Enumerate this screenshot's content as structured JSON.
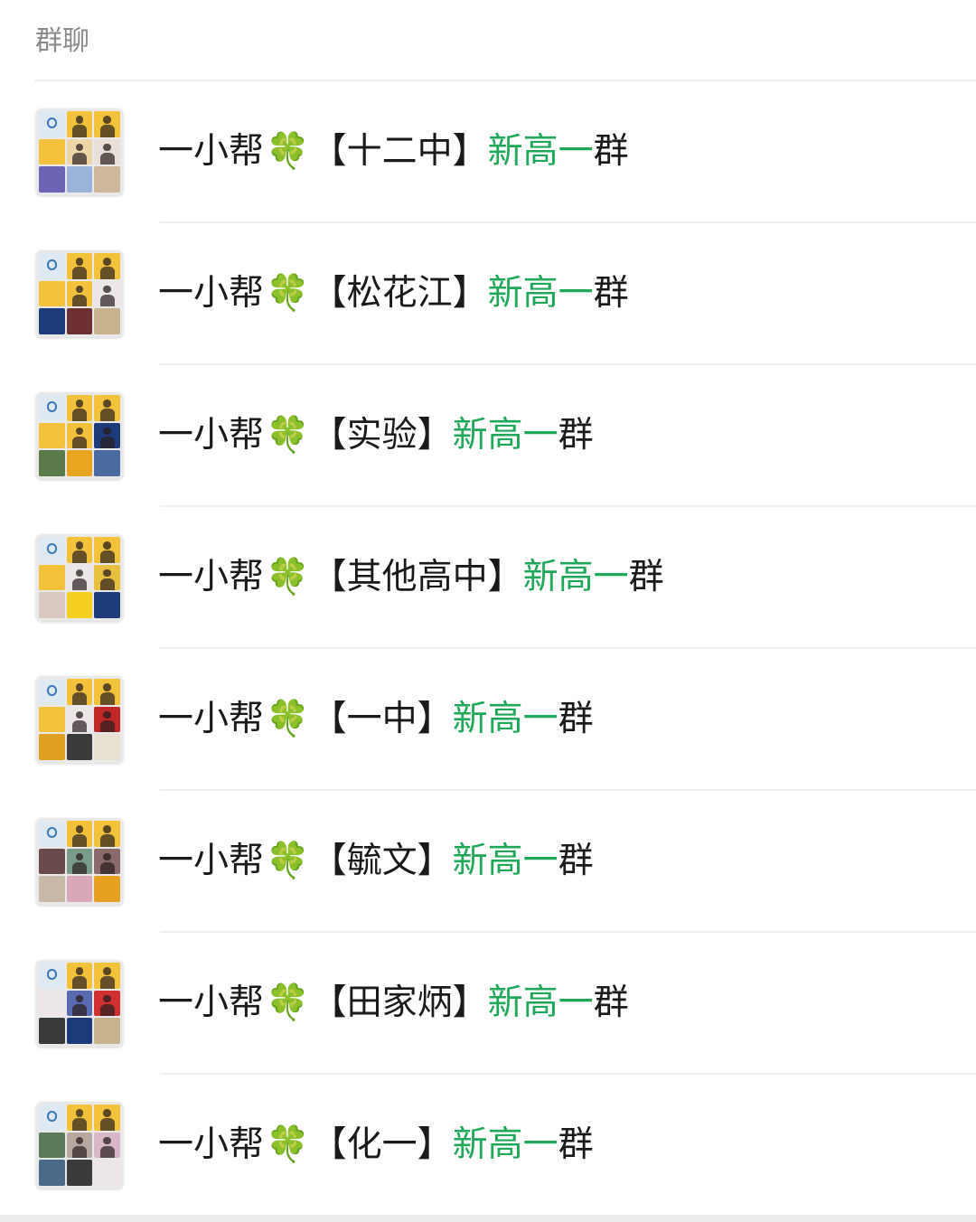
{
  "section": {
    "title": "群聊"
  },
  "groups": [
    {
      "prefix": "一小帮",
      "emoji": "🍀",
      "school": "【十二中】",
      "suffix": "新高一",
      "tail": "群",
      "avatar_colors": [
        "logo",
        "#f2c23a",
        "#f2c23a",
        "#f2c23a",
        "#efd6a8",
        "#e8e0d8",
        "#6d63b5",
        "#9bb3d8",
        "#cfb89a"
      ]
    },
    {
      "prefix": "一小帮",
      "emoji": "🍀",
      "school": "【松花江】",
      "suffix": "新高一",
      "tail": "群",
      "avatar_colors": [
        "logo",
        "#f2c23a",
        "#f2c23a",
        "#f2c23a",
        "#f2c23a",
        "#ece6e6",
        "#1d3a7a",
        "#6e3030",
        "#c9b28e"
      ]
    },
    {
      "prefix": "一小帮",
      "emoji": "🍀",
      "school": "【实验】",
      "suffix": "新高一",
      "tail": "群",
      "avatar_colors": [
        "logo",
        "#f2c23a",
        "#f2c23a",
        "#f2c23a",
        "#f2c23a",
        "#1d3a7a",
        "#5a7a4a",
        "#e8a620",
        "#4a6ba0"
      ]
    },
    {
      "prefix": "一小帮",
      "emoji": "🍀",
      "school": "【其他高中】",
      "suffix": "新高一",
      "tail": "群",
      "avatar_colors": [
        "logo",
        "#f2c23a",
        "#f2c23a",
        "#f2c23a",
        "#ece6e6",
        "#e8c040",
        "#d8c8c0",
        "#f5d020",
        "#1d3a7a"
      ]
    },
    {
      "prefix": "一小帮",
      "emoji": "🍀",
      "school": "【一中】",
      "suffix": "新高一",
      "tail": "群",
      "avatar_colors": [
        "logo",
        "#f2c23a",
        "#f2c23a",
        "#f2c23a",
        "#ece6e6",
        "#c02828",
        "#e0a020",
        "#3a3a3a",
        "#e8e0d0"
      ]
    },
    {
      "prefix": "一小帮",
      "emoji": "🍀",
      "school": "【毓文】",
      "suffix": "新高一",
      "tail": "群",
      "avatar_colors": [
        "logo",
        "#f2c23a",
        "#f2c23a",
        "#6a4a4a",
        "#7a9a8a",
        "#8a6a6a",
        "#c8b8a8",
        "#d8a8b8",
        "#e8a020"
      ]
    },
    {
      "prefix": "一小帮",
      "emoji": "🍀",
      "school": "【田家炳】",
      "suffix": "新高一",
      "tail": "群",
      "avatar_colors": [
        "logo",
        "#f2c23a",
        "#f2c23a",
        "#ece6e6",
        "#5a6ab0",
        "#d03030",
        "#3a3a3a",
        "#1d3a7a",
        "#c9b28e"
      ]
    },
    {
      "prefix": "一小帮",
      "emoji": "🍀",
      "school": "【化一】",
      "suffix": "新高一",
      "tail": "群",
      "avatar_colors": [
        "logo",
        "#f2c23a",
        "#f2c23a",
        "#5a7a5a",
        "#b8a8a0",
        "#d8b8c8",
        "#4a6a8a",
        "#3a3a3a",
        "#ece6e6"
      ]
    }
  ]
}
